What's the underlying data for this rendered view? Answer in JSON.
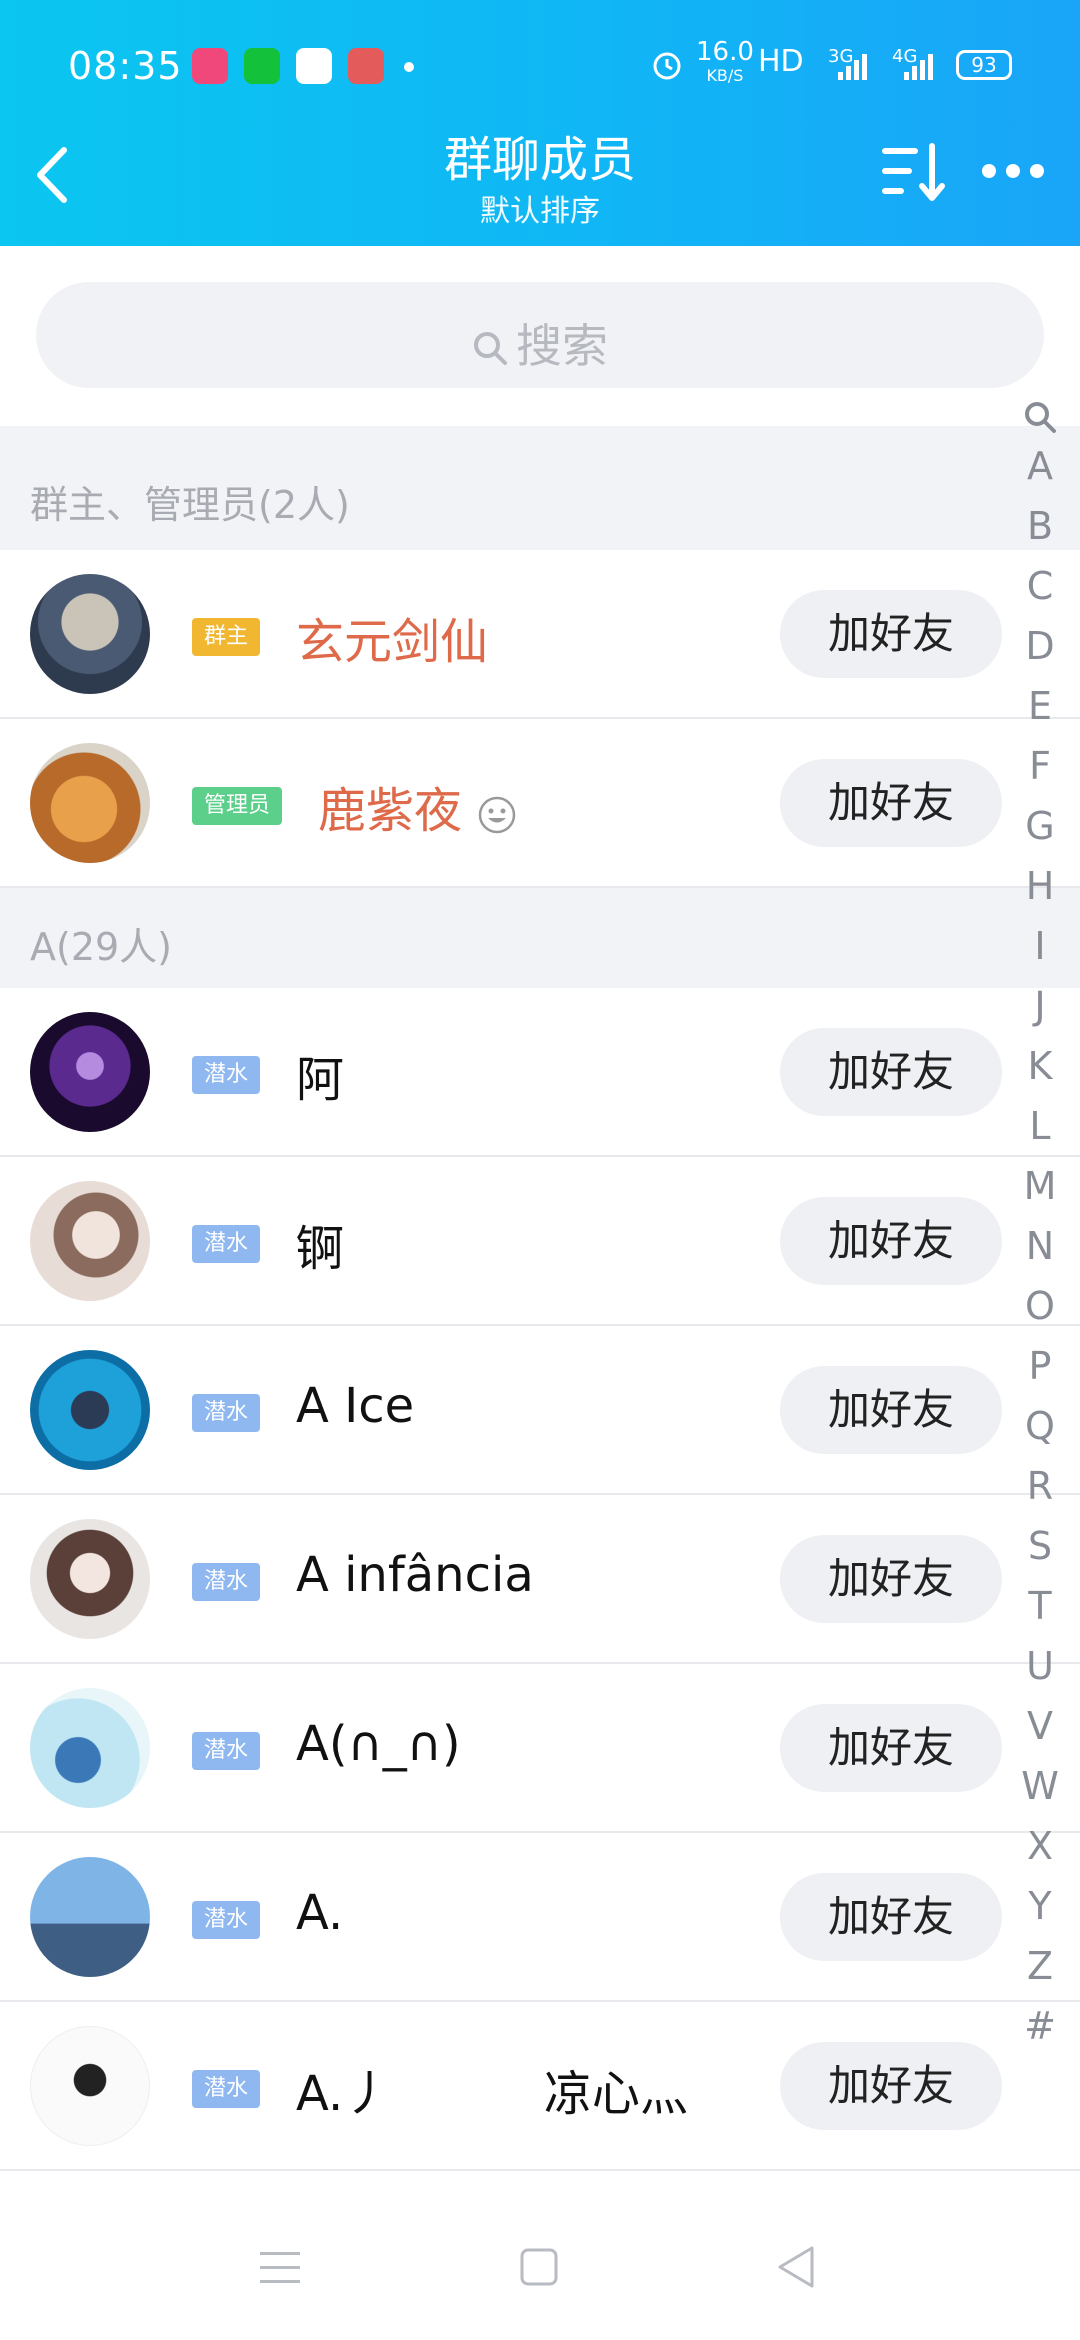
{
  "status": {
    "time": "08:35",
    "network_speed": "16.0",
    "network_unit": "KB/S",
    "hd": "HD",
    "signal1": "3G",
    "signal2": "4G",
    "battery": "93"
  },
  "header": {
    "title": "群聊成员",
    "subtitle": "默认排序"
  },
  "search": {
    "placeholder": "搜索"
  },
  "sections": [
    {
      "label": "群主、管理员(2人)",
      "members": [
        {
          "badge": "群主",
          "badge_color": "#f2b731",
          "name": "玄元剑仙",
          "name_color": "#de6a4a",
          "button": "加好友"
        },
        {
          "badge": "管理员",
          "badge_color": "#5ccf8a",
          "name": "鹿紫夜",
          "name_color": "#de6a4a",
          "button": "加好友"
        }
      ]
    },
    {
      "label": "A(29人)",
      "members": [
        {
          "badge": "潜水",
          "badge_color": "#8fb7f0",
          "name": "阿",
          "button": "加好友"
        },
        {
          "badge": "潜水",
          "badge_color": "#8fb7f0",
          "name": "锕",
          "button": "加好友"
        },
        {
          "badge": "潜水",
          "badge_color": "#8fb7f0",
          "name": "A Ice",
          "button": "加好友"
        },
        {
          "badge": "潜水",
          "badge_color": "#8fb7f0",
          "name": "A infância",
          "button": "加好友"
        },
        {
          "badge": "潜水",
          "badge_color": "#8fb7f0",
          "name": "A(∩_∩)",
          "button": "加好友"
        },
        {
          "badge": "潜水",
          "badge_color": "#8fb7f0",
          "name": "A.",
          "button": "加好友"
        },
        {
          "badge": "潜水",
          "badge_color": "#8fb7f0",
          "name": "A.丿          凉心灬",
          "button": "加好友"
        }
      ]
    }
  ],
  "index_letters": [
    "A",
    "B",
    "C",
    "D",
    "E",
    "F",
    "G",
    "H",
    "I",
    "J",
    "K",
    "L",
    "M",
    "N",
    "O",
    "P",
    "Q",
    "R",
    "S",
    "T",
    "U",
    "V",
    "W",
    "X",
    "Y",
    "Z",
    "#"
  ],
  "colors": {
    "header_start": "#0bc6f0",
    "header_end": "#1aa5f8"
  }
}
